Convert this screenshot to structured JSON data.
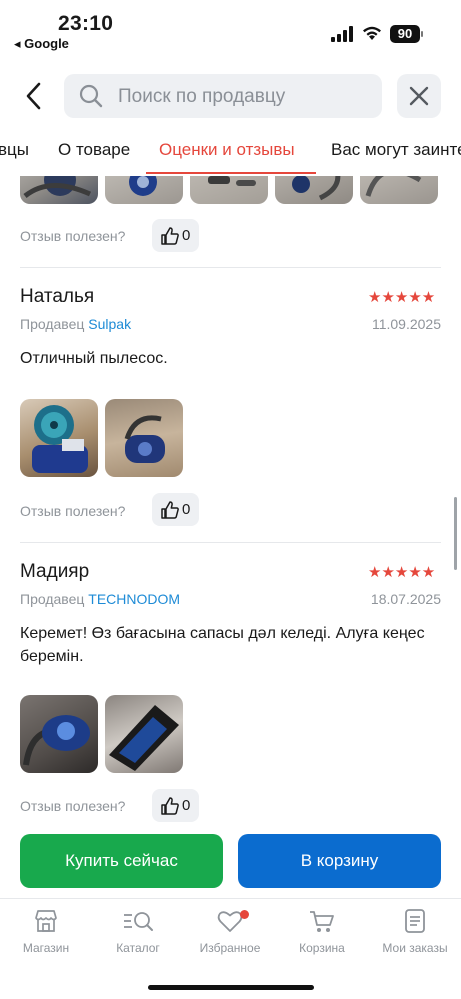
{
  "status_bar": {
    "time": "23:10",
    "back_app": "◂ Google",
    "battery": "90"
  },
  "search": {
    "placeholder": "Поиск по продавцу"
  },
  "tabs": [
    {
      "label": "вцы"
    },
    {
      "label": "О товаре"
    },
    {
      "label": "Оценки и отзывы",
      "active": true
    },
    {
      "label": "Вас могут заинтересовать"
    }
  ],
  "reviews": {
    "helpful_label": "Отзыв полезен?",
    "seller_prefix": "Продавец",
    "top_helpful_count": "0",
    "items": [
      {
        "author": "Наталья",
        "rating": 5,
        "stars": "★★★★★",
        "seller": "Sulpak",
        "date": "11.09.2025",
        "text": "Отличный пылесос.",
        "helpful_count": "0"
      },
      {
        "author": "Мадияр",
        "rating": 5,
        "stars": "★★★★★",
        "seller": "TECHNODOM",
        "date": "18.07.2025",
        "text": "Керемет! Өз бағасына сапасы дәл келеді. Алуға кеңес беремін.",
        "helpful_count": "0"
      }
    ]
  },
  "actions": {
    "buy_now": "Купить сейчас",
    "add_to_cart": "В корзину"
  },
  "bottom_nav": [
    {
      "label": "Магазин",
      "icon": "store-icon"
    },
    {
      "label": "Каталог",
      "icon": "catalog-search-icon"
    },
    {
      "label": "Избранное",
      "icon": "heart-icon",
      "badge": true
    },
    {
      "label": "Корзина",
      "icon": "cart-icon"
    },
    {
      "label": "Мои заказы",
      "icon": "orders-icon"
    }
  ],
  "colors": {
    "accent_red": "#e5473c",
    "buy_green": "#18a94d",
    "cart_blue": "#0b6ccf",
    "seller_link": "#1e8bd6"
  }
}
